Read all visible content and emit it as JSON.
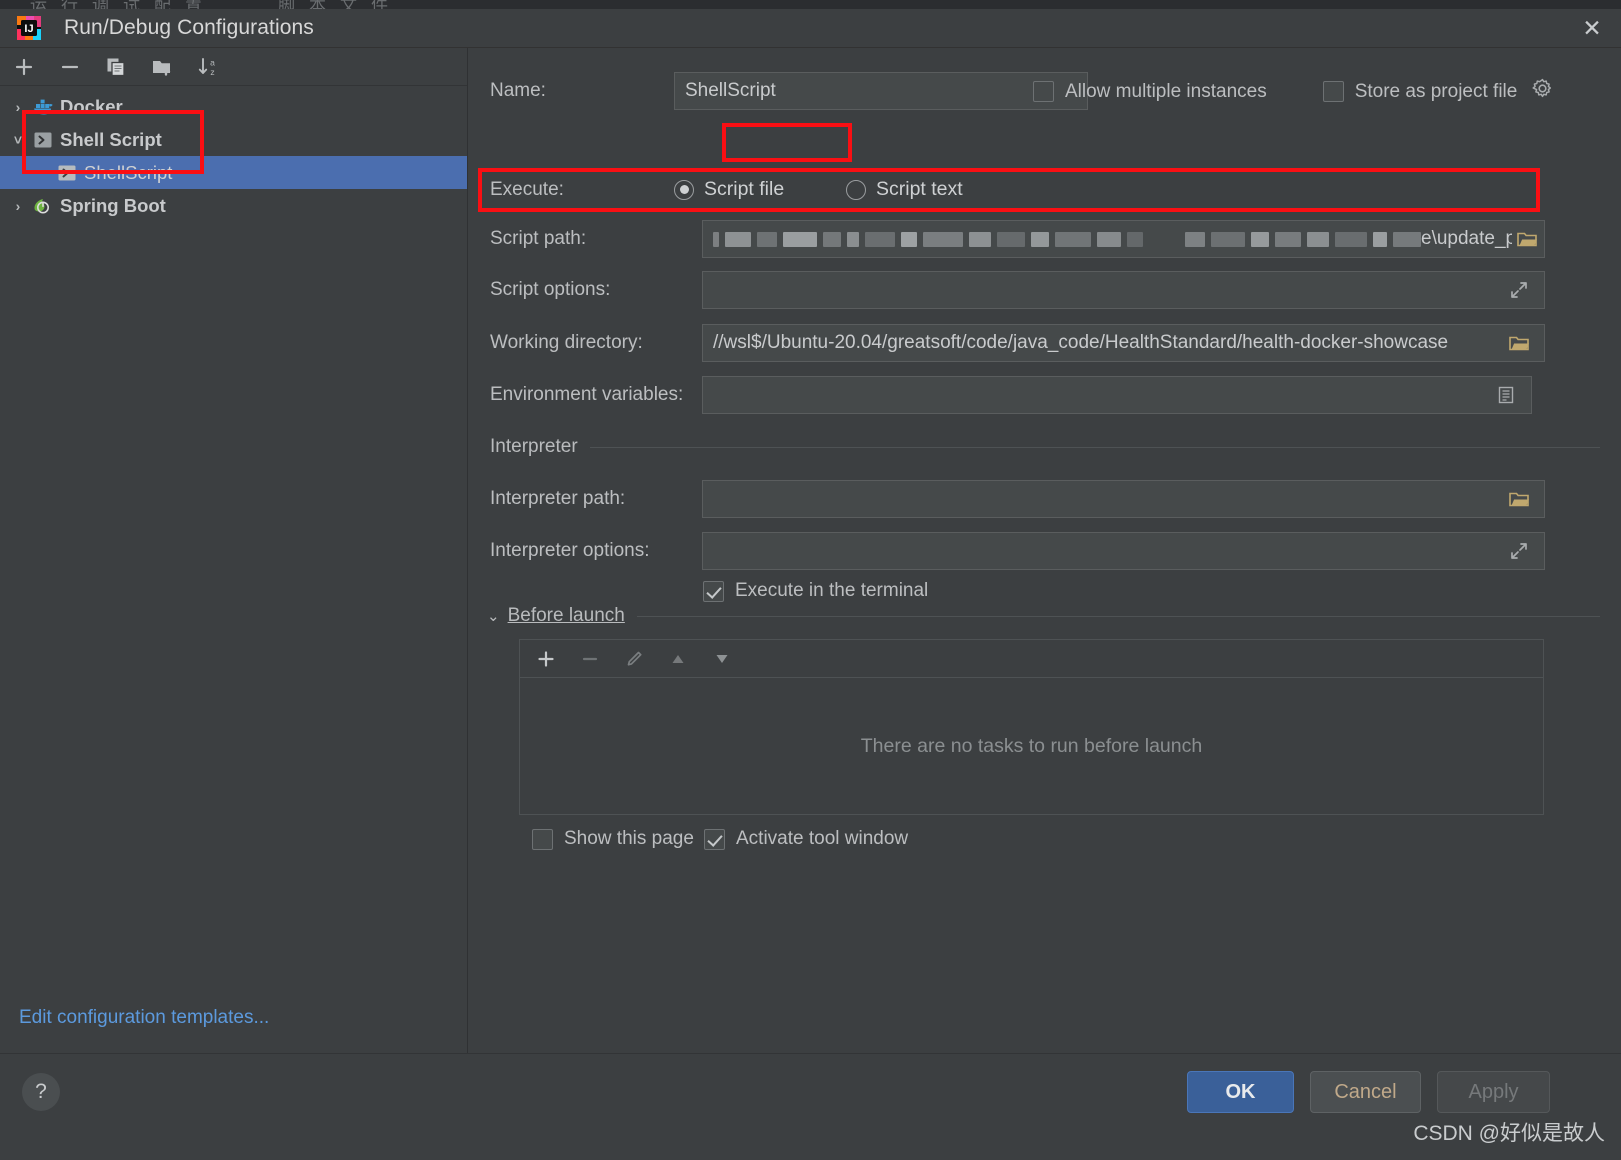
{
  "window": {
    "title": "Run/Debug Configurations",
    "close_icon": "close-icon",
    "app_icon": "intellij-idea-logo",
    "background_sliver_text": "运行调试配置　　脚本文件"
  },
  "tree_toolbar": {
    "items": [
      {
        "name": "add-configuration-button",
        "icon": "plus-icon",
        "glyph": "+"
      },
      {
        "name": "remove-configuration-button",
        "icon": "minus-icon",
        "glyph": "−"
      },
      {
        "name": "copy-configuration-button",
        "icon": "copy-icon",
        "glyph": "copy"
      },
      {
        "name": "new-folder-button",
        "icon": "folder-add-icon",
        "glyph": "folder"
      },
      {
        "name": "sort-configurations-button",
        "icon": "sort-alphabetical-icon",
        "glyph": "sort"
      }
    ]
  },
  "tree": {
    "nodes": [
      {
        "label": "Docker",
        "icon": "docker-icon",
        "twisty": "›",
        "level": 0,
        "selected": false,
        "bold": true
      },
      {
        "label": "Shell Script",
        "icon": "shell-script-icon",
        "twisty": "˅",
        "level": 0,
        "selected": false,
        "bold": true
      },
      {
        "label": "ShellScript",
        "icon": "shell-script-icon",
        "twisty": "",
        "level": 1,
        "selected": true,
        "bold": false
      },
      {
        "label": "Spring Boot",
        "icon": "spring-boot-icon",
        "twisty": "›",
        "level": 0,
        "selected": false,
        "bold": true
      }
    ],
    "edit_templates_link": "Edit configuration templates..."
  },
  "form": {
    "name_label": "Name:",
    "name_value": "ShellScript",
    "allow_multiple_instances": {
      "label": "Allow multiple instances",
      "checked": false
    },
    "store_as_project_file": {
      "label": "Store as project file",
      "checked": false,
      "gear_icon": "gear-icon"
    },
    "execute_label": "Execute:",
    "execute_options": [
      {
        "label": "Script file",
        "selected": true
      },
      {
        "label": "Script text",
        "selected": false
      }
    ],
    "script_path_label": "Script path:",
    "script_path_value_visible": "e\\update_pg_password.sh",
    "script_path_prefix_redacted": true,
    "script_path_browse_icon": "folder-browse-icon",
    "script_options_label": "Script options:",
    "script_options_value": "",
    "script_options_expand_icon": "expand-icon",
    "working_directory_label": "Working directory:",
    "working_directory_value": "//wsl$/Ubuntu-20.04/greatsoft/code/java_code/HealthStandard/health-docker-showcase",
    "working_directory_browse_icon": "folder-browse-icon",
    "environment_variables_label": "Environment variables:",
    "environment_variables_value": "",
    "environment_variables_icon": "environment-list-icon",
    "interpreter_section_label": "Interpreter",
    "interpreter_path_label": "Interpreter path:",
    "interpreter_path_value": "",
    "interpreter_path_browse_icon": "folder-browse-icon",
    "interpreter_options_label": "Interpreter options:",
    "interpreter_options_value": "",
    "interpreter_options_expand_icon": "expand-icon",
    "execute_in_terminal": {
      "label": "Execute in the terminal",
      "checked": true
    }
  },
  "before_launch": {
    "section_label": "Before launch",
    "collapse_icon": "chevron-down-icon",
    "toolbar": [
      {
        "name": "add-task-button",
        "icon": "plus-icon",
        "glyph": "+",
        "enabled": true
      },
      {
        "name": "remove-task-button",
        "icon": "minus-icon",
        "glyph": "−",
        "enabled": false
      },
      {
        "name": "edit-task-button",
        "icon": "pencil-icon",
        "glyph": "pencil",
        "enabled": false
      },
      {
        "name": "move-task-up-button",
        "icon": "arrow-up-icon",
        "glyph": "▲",
        "enabled": false
      },
      {
        "name": "move-task-down-button",
        "icon": "arrow-down-icon",
        "glyph": "▼",
        "enabled": true
      }
    ],
    "empty_text": "There are no tasks to run before launch",
    "show_this_page": {
      "label": "Show this page",
      "checked": false
    },
    "activate_tool_window": {
      "label": "Activate tool window",
      "checked": true
    }
  },
  "footer": {
    "help_label": "?",
    "ok_label": "OK",
    "cancel_label": "Cancel",
    "apply_label": "Apply"
  },
  "watermark": "CSDN @好似是故人",
  "colors": {
    "background": "#3c3f41",
    "field_background": "#45494a",
    "selection_blue": "#4b6eaf",
    "link_blue": "#5c9ade",
    "annotation_red": "#fa0f13",
    "ok_button": "#3a6099"
  }
}
